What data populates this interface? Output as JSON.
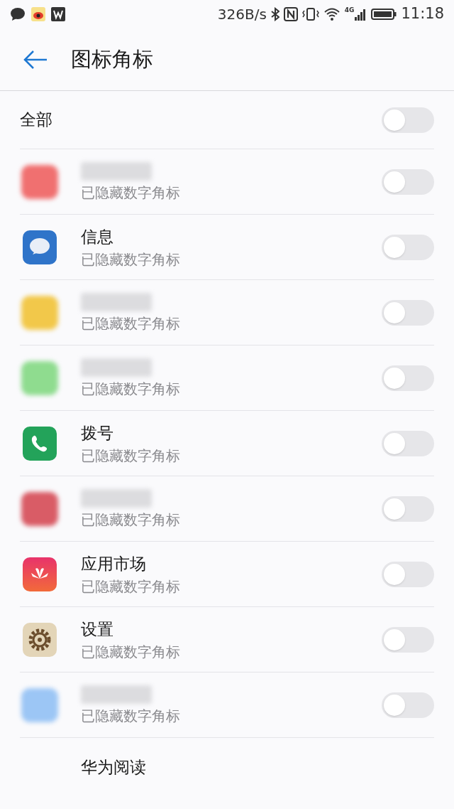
{
  "status_bar": {
    "speed": "326B/s",
    "network": "4G",
    "time": "11:18"
  },
  "header": {
    "title": "图标角标"
  },
  "all_toggle": {
    "label": "全部",
    "on": false
  },
  "apps": [
    {
      "kind": "blurred",
      "color": "#f07070",
      "subtitle": "已隐藏数字角标",
      "on": false
    },
    {
      "kind": "messages",
      "name": "信息",
      "subtitle": "已隐藏数字角标",
      "on": false
    },
    {
      "kind": "blurred",
      "color": "#f2c84a",
      "subtitle": "已隐藏数字角标",
      "on": false
    },
    {
      "kind": "blurred",
      "color": "#8fdc8f",
      "subtitle": "已隐藏数字角标",
      "on": false
    },
    {
      "kind": "dialer",
      "name": "拨号",
      "subtitle": "已隐藏数字角标",
      "on": false
    },
    {
      "kind": "blurred",
      "color": "#d95c66",
      "subtitle": "已隐藏数字角标",
      "on": false
    },
    {
      "kind": "store",
      "name": "应用市场",
      "subtitle": "已隐藏数字角标",
      "on": false
    },
    {
      "kind": "settings",
      "name": "设置",
      "subtitle": "已隐藏数字角标",
      "on": false
    },
    {
      "kind": "blurred",
      "color": "#9cc6f5",
      "subtitle": "已隐藏数字角标",
      "on": false
    },
    {
      "kind": "partial",
      "name": "华为阅读"
    }
  ]
}
